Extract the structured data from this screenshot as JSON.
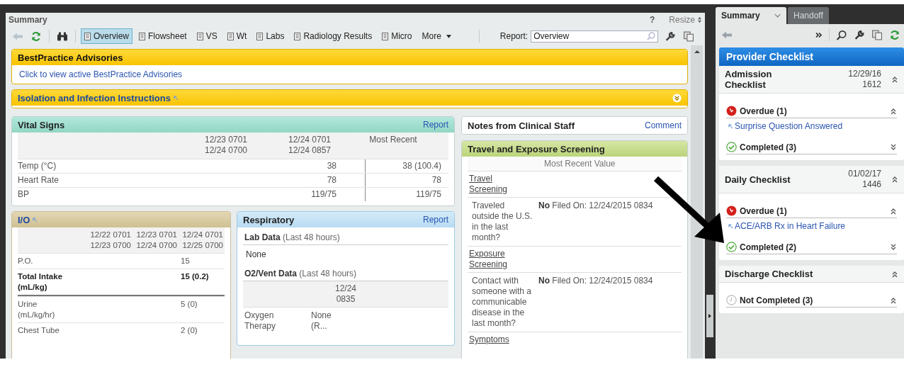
{
  "main": {
    "title": "Summary",
    "help": "?",
    "resize": "Resize",
    "toolbar_tabs": [
      {
        "label": "Overview",
        "selected": true
      },
      {
        "label": "Flowsheet",
        "selected": false
      },
      {
        "label": "VS",
        "selected": false
      },
      {
        "label": "Wt",
        "selected": false
      },
      {
        "label": "Labs",
        "selected": false
      },
      {
        "label": "Radiology Results",
        "selected": false
      },
      {
        "label": "Micro",
        "selected": false
      }
    ],
    "more": "More",
    "report_label": "Report:",
    "report_value": "Overview"
  },
  "advisories": {
    "title": "BestPractice Advisories",
    "link": "Click to view active BestPractice Advisories"
  },
  "isolation": {
    "title": "Isolation and Infection Instructions",
    "expanded": false
  },
  "vital_signs": {
    "title": "Vital Signs",
    "action": "Report",
    "columns": [
      "12/23 0701 12/24 0700",
      "12/24 0701 12/24 0857",
      "Most Recent"
    ],
    "rows": [
      {
        "label": "Temp (°C)",
        "cells": [
          null,
          "38",
          "38 (100.4)"
        ]
      },
      {
        "label": "Heart Rate",
        "cells": [
          null,
          "78",
          "78"
        ]
      },
      {
        "label": "BP",
        "cells": [
          null,
          "119/75",
          "119/75"
        ]
      }
    ]
  },
  "io": {
    "title": "I/O",
    "columns": [
      "12/22 0701 12/23 0700",
      "12/23 0701 12/24 0700",
      "12/24 0701 12/25 0700"
    ],
    "rows": [
      {
        "label": "P.O.",
        "bold": false,
        "cells": [
          null,
          null,
          "15"
        ]
      },
      {
        "label": "Total Intake (mL/kg)",
        "bold": true,
        "cells": [
          null,
          null,
          "15 (0.2)"
        ]
      },
      {
        "label": "Urine (mL/kg/hr)",
        "bold": false,
        "cells": [
          null,
          null,
          "5 (0)"
        ]
      },
      {
        "label": "Chest Tube",
        "bold": false,
        "cells": [
          null,
          null,
          "2 (0)"
        ]
      }
    ]
  },
  "respiratory": {
    "title": "Respiratory",
    "action": "Report",
    "lab_data": {
      "label": "Lab Data",
      "note": "(Last 48 hours)",
      "value": "None"
    },
    "vent_data": {
      "label": "O2/Vent Data",
      "note": "(Last 48 hours)",
      "column": "12/24 0835",
      "rows": [
        {
          "label": "Oxygen Therapy",
          "value": "None (R..."
        }
      ]
    }
  },
  "notes": {
    "title": "Notes from Clinical Staff",
    "action": "Comment"
  },
  "travel": {
    "title": "Travel and Exposure Screening",
    "column": "Most Recent Value",
    "items": [
      {
        "kind": "section",
        "label": "Travel Screening"
      },
      {
        "kind": "question",
        "label": "Traveled outside the U.S. in the last month?",
        "answer": "No",
        "filed": "Filed On: 12/24/2015 0834"
      },
      {
        "kind": "section",
        "label": "Exposure Screening"
      },
      {
        "kind": "question",
        "label": "Contact with someone with a communicable disease in the last month?",
        "answer": "No",
        "filed": "Filed On: 12/24/2015 0834"
      },
      {
        "kind": "section",
        "label": "Symptoms"
      }
    ]
  },
  "side": {
    "tabs": [
      {
        "label": "Summary",
        "selected": true
      },
      {
        "label": "Handoff",
        "selected": false
      }
    ],
    "checklist_title": "Provider Checklist",
    "sections": [
      {
        "title": "Admission Checklist",
        "date": "12/29/16",
        "time": "1612",
        "expanded": true,
        "groups": [
          {
            "kind": "overdue",
            "label": "Overdue (1)",
            "expanded": true,
            "items": [
              "Surprise Question Answered"
            ]
          },
          {
            "kind": "completed",
            "label": "Completed (3)",
            "expanded": false
          }
        ]
      },
      {
        "title": "Daily Checklist",
        "date": "01/02/17",
        "time": "1446",
        "expanded": true,
        "groups": [
          {
            "kind": "overdue",
            "label": "Overdue (1)",
            "expanded": true,
            "items": [
              "ACE/ARB Rx in Heart Failure"
            ]
          },
          {
            "kind": "completed",
            "label": "Completed (2)",
            "expanded": false
          }
        ]
      },
      {
        "title": "Discharge Checklist",
        "expanded": true,
        "groups": [
          {
            "kind": "not_completed",
            "label": "Not Completed (3)",
            "expanded": true
          }
        ]
      }
    ]
  }
}
